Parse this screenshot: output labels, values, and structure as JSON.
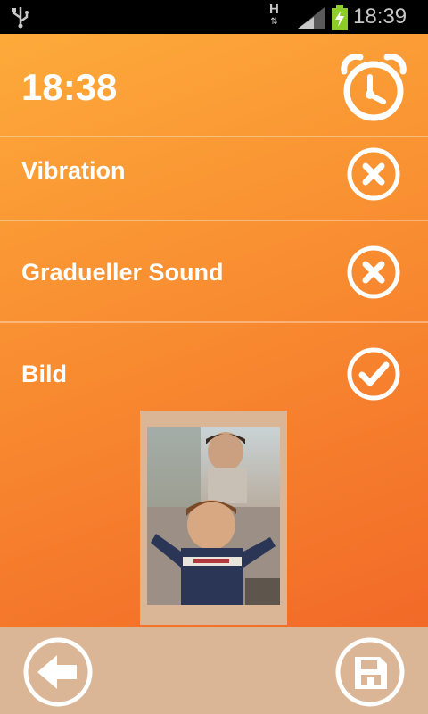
{
  "status_bar": {
    "time": "18:39",
    "network_type": "H",
    "icons": [
      "usb-icon",
      "data-arrows-icon",
      "signal-icon",
      "battery-charging-icon"
    ]
  },
  "header": {
    "alarm_time": "18:38",
    "icon": "alarm-clock-icon"
  },
  "settings": [
    {
      "label": "Vibration",
      "enabled": false,
      "icon": "close-circle-icon"
    },
    {
      "label": "Gradueller Sound",
      "enabled": false,
      "icon": "close-circle-icon"
    },
    {
      "label": "Bild",
      "enabled": true,
      "icon": "check-circle-icon"
    }
  ],
  "image_preview": {
    "description_icon": "photo"
  },
  "bottom_bar": {
    "back_icon": "back-arrow-icon",
    "save_icon": "save-icon"
  },
  "colors": {
    "accent_orange_light": "#fdaa3a",
    "accent_orange_dark": "#f26a28",
    "bottom_bar": "#dbb696",
    "text": "#ffffff"
  }
}
